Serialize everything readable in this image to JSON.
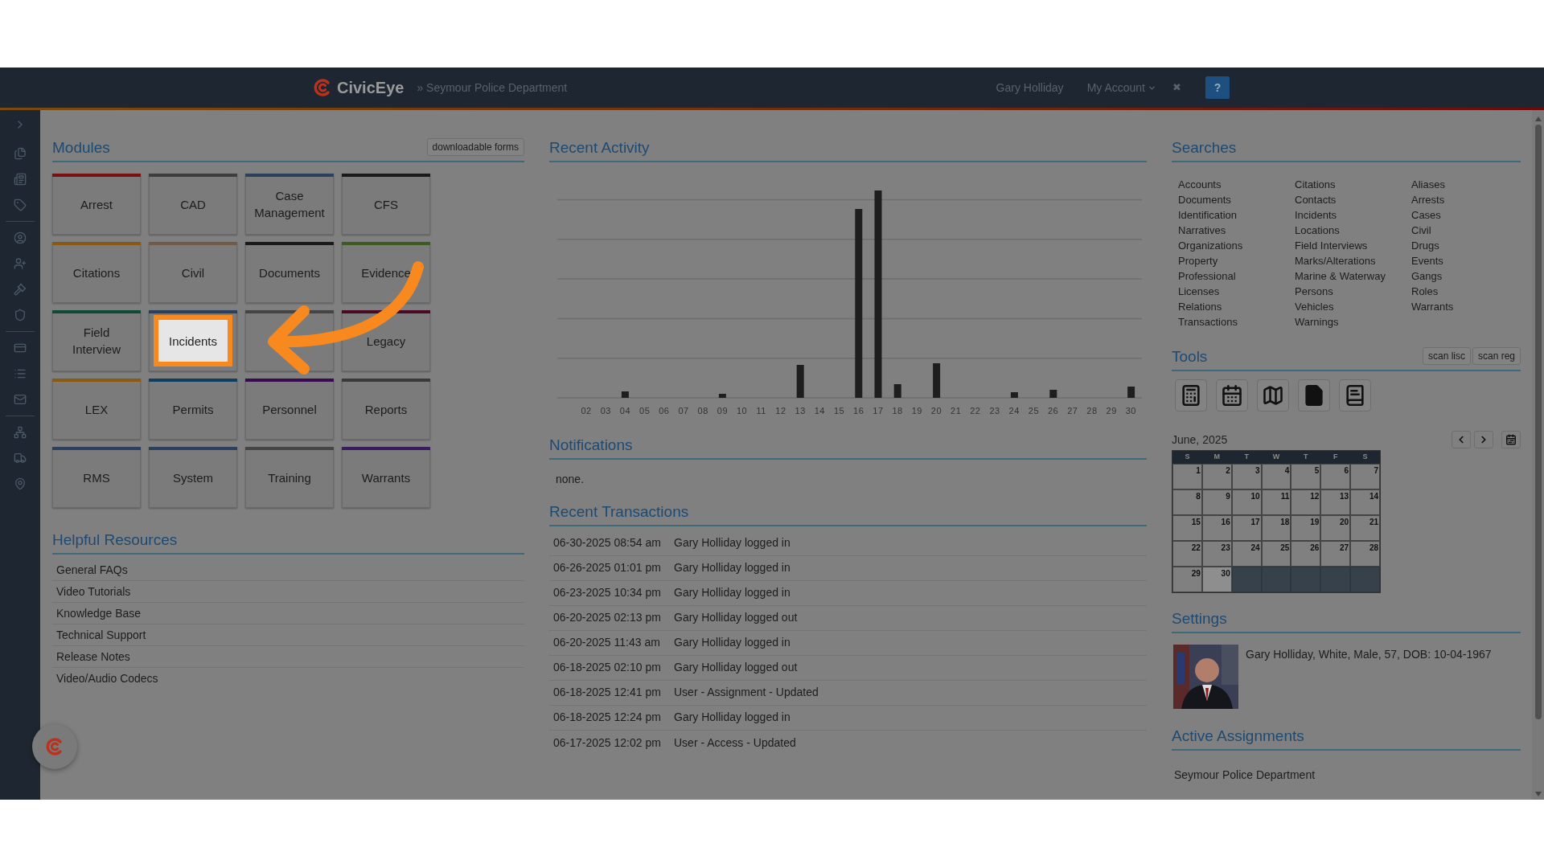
{
  "header": {
    "brand": "CivicEye",
    "department": "» Seymour Police Department",
    "user": "Gary Holliday",
    "account_menu": "My Account",
    "close": "✖",
    "help": "?"
  },
  "modules": {
    "title": "Modules",
    "forms_button": "downloadable forms",
    "tiles": [
      {
        "label": "Arrest",
        "color": "#7a1010",
        "highlighted": false
      },
      {
        "label": "CAD",
        "color": "#3d3d3d",
        "highlighted": false
      },
      {
        "label": "Case Management",
        "color": "#2a405c",
        "highlighted": false
      },
      {
        "label": "CFS",
        "color": "#1a1a1a",
        "highlighted": false
      },
      {
        "label": "Citations",
        "color": "#8a5a12",
        "highlighted": false
      },
      {
        "label": "Civil",
        "color": "#6f5d48",
        "highlighted": false
      },
      {
        "label": "Documents",
        "color": "#1a1a1a",
        "highlighted": false
      },
      {
        "label": "Evidence",
        "color": "#3f5a20",
        "highlighted": false
      },
      {
        "label": "Field Interview",
        "color": "#0f4a35",
        "highlighted": false
      },
      {
        "label": "Incidents",
        "color": "#2a405c",
        "highlighted": true
      },
      {
        "color": "#444444",
        "highlighted": false
      },
      {
        "label": "Legacy",
        "color": "#4a0a25",
        "highlighted": false
      },
      {
        "label": "LEX",
        "color": "#8a5a12",
        "highlighted": false
      },
      {
        "label": "Permits",
        "color": "#0f3f60",
        "highlighted": false
      },
      {
        "label": "Personnel",
        "color": "#3a0a50",
        "highlighted": false
      },
      {
        "label": "Reports",
        "color": "#3a3a3a",
        "highlighted": false
      },
      {
        "label": "RMS",
        "color": "#2a405c",
        "highlighted": false
      },
      {
        "label": "System",
        "color": "#2a405c",
        "highlighted": false
      },
      {
        "label": "Training",
        "color": "#454545",
        "highlighted": false
      },
      {
        "label": "Warrants",
        "color": "#3a1a60",
        "highlighted": false
      }
    ]
  },
  "helpful_resources": {
    "title": "Helpful Resources",
    "links": [
      "General FAQs",
      "Video Tutorials",
      "Knowledge Base",
      "Technical Support",
      "Release Notes",
      "Video/Audio Codecs"
    ]
  },
  "recent_activity": {
    "title": "Recent Activity",
    "day_labels": [
      "02",
      "03",
      "04",
      "05",
      "06",
      "07",
      "08",
      "09",
      "10",
      "11",
      "12",
      "13",
      "14",
      "15",
      "16",
      "17",
      "18",
      "19",
      "20",
      "21",
      "22",
      "23",
      "24",
      "25",
      "26",
      "27",
      "28",
      "29",
      "30"
    ]
  },
  "notifications": {
    "title": "Notifications",
    "text": "none."
  },
  "recent_transactions": {
    "title": "Recent Transactions",
    "rows": [
      {
        "time": "06-30-2025 08:54 am",
        "event": "Gary Holliday logged in"
      },
      {
        "time": "06-26-2025 01:01 pm",
        "event": "Gary Holliday logged in"
      },
      {
        "time": "06-23-2025 10:34 pm",
        "event": "Gary Holliday logged in"
      },
      {
        "time": "06-20-2025 02:13 pm",
        "event": "Gary Holliday logged out"
      },
      {
        "time": "06-20-2025 11:43 am",
        "event": "Gary Holliday logged in"
      },
      {
        "time": "06-18-2025 02:10 pm",
        "event": "Gary Holliday logged out"
      },
      {
        "time": "06-18-2025 12:41 pm",
        "event": "User - Assignment - Updated"
      },
      {
        "time": "06-18-2025 12:24 pm",
        "event": "Gary Holliday logged in"
      },
      {
        "time": "06-17-2025 12:02 pm",
        "event": "User - Access - Updated"
      }
    ]
  },
  "searches": {
    "title": "Searches",
    "columns": [
      [
        "Accounts",
        "Documents",
        "Identification",
        "Narratives",
        "Organizations",
        "Property",
        "Professional",
        "Licenses",
        "Relations",
        "Transactions"
      ],
      [
        "Citations",
        "Contacts",
        "Incidents",
        "Locations",
        "Field Interviews",
        "Marks/Alterations",
        "Marine & Waterway",
        "Persons",
        "Vehicles",
        "Warnings"
      ],
      [
        "Aliases",
        "Arrests",
        "Cases",
        "Civil",
        "Drugs",
        "Events",
        "Gangs",
        "Roles",
        "Warrants"
      ]
    ]
  },
  "tools": {
    "title": "Tools",
    "scan_buttons": [
      "scan lisc",
      "scan reg"
    ]
  },
  "calendar": {
    "month": "June, 2025",
    "weekdays": [
      "S",
      "M",
      "T",
      "W",
      "T",
      "F",
      "S"
    ],
    "days": [
      {
        "label": "1",
        "today": false
      },
      {
        "label": "2",
        "today": false
      },
      {
        "label": "3",
        "today": false
      },
      {
        "label": "4",
        "today": false
      },
      {
        "label": "5",
        "today": false
      },
      {
        "label": "6",
        "today": false
      },
      {
        "label": "7",
        "today": false
      },
      {
        "label": "8",
        "today": false
      },
      {
        "label": "9",
        "today": false
      },
      {
        "label": "10",
        "today": false
      },
      {
        "label": "11",
        "today": false
      },
      {
        "label": "12",
        "today": false
      },
      {
        "label": "13",
        "today": false
      },
      {
        "label": "14",
        "today": false
      },
      {
        "label": "15",
        "today": false
      },
      {
        "label": "16",
        "today": false
      },
      {
        "label": "17",
        "today": false
      },
      {
        "label": "18",
        "today": false
      },
      {
        "label": "19",
        "today": false
      },
      {
        "label": "20",
        "today": false
      },
      {
        "label": "21",
        "today": false
      },
      {
        "label": "22",
        "today": false
      },
      {
        "label": "23",
        "today": false
      },
      {
        "label": "24",
        "today": false
      },
      {
        "label": "25",
        "today": false
      },
      {
        "label": "26",
        "today": false
      },
      {
        "label": "27",
        "today": false
      },
      {
        "label": "28",
        "today": false
      },
      {
        "label": "29",
        "today": false
      },
      {
        "label": "30",
        "today": true
      }
    ]
  },
  "settings": {
    "title": "Settings",
    "profile": "Gary Holliday, White, Male, 57, DOB: 10-04-1967"
  },
  "active_assignments": {
    "title": "Active Assignments",
    "items": [
      "Seymour Police Department"
    ]
  }
}
